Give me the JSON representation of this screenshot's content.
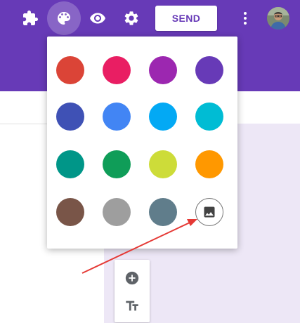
{
  "toolbar": {
    "send_label": "SEND",
    "icons": [
      "puzzle-icon",
      "palette-icon",
      "eye-icon",
      "gear-icon",
      "more-vert-icon"
    ]
  },
  "colors": {
    "theme": "#673ab7",
    "background": "#ede7f6"
  },
  "palette": {
    "swatches": [
      {
        "color": "#db4437"
      },
      {
        "color": "#e91e63"
      },
      {
        "color": "#9c27b0"
      },
      {
        "color": "#673ab7"
      },
      {
        "color": "#3f51b5"
      },
      {
        "color": "#4285f4"
      },
      {
        "color": "#03a9f4"
      },
      {
        "color": "#00bcd4"
      },
      {
        "color": "#009688"
      },
      {
        "color": "#0f9d58"
      },
      {
        "color": "#cddc39"
      },
      {
        "color": "#ff9800"
      },
      {
        "color": "#795548"
      },
      {
        "color": "#9e9e9e"
      },
      {
        "color": "#607d8b"
      }
    ],
    "image_option_icon": "image-icon"
  },
  "side_tools": [
    "add-circle-icon",
    "text-title-icon"
  ]
}
